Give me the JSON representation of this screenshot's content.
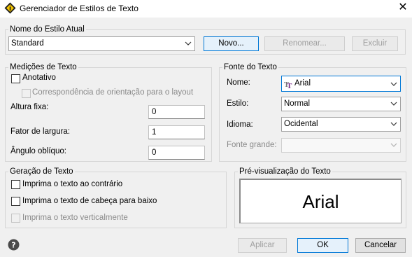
{
  "window": {
    "title": "Gerenciador de Estilos de Texto",
    "close_glyph": "✕"
  },
  "current_style": {
    "group_label": "Nome do Estilo Atual",
    "selected": "Standard",
    "new_button": "Novo...",
    "rename_button": "Renomear...",
    "delete_button": "Excluir"
  },
  "measurements": {
    "group_label": "Medições de Texto",
    "annotative_label": "Anotativo",
    "annotative_checked": false,
    "orientation_label": "Correspondência de orientação para o layout",
    "orientation_checked": false,
    "fixed_height_label": "Altura fixa:",
    "fixed_height_value": "0",
    "width_factor_label": "Fator de largura:",
    "width_factor_value": "1",
    "oblique_angle_label": "Ângulo oblíquo:",
    "oblique_angle_value": "0"
  },
  "font": {
    "group_label": "Fonte do Texto",
    "name_label": "Nome:",
    "name_value": "Arial",
    "name_icon": "truetype-font-icon",
    "style_label": "Estilo:",
    "style_value": "Normal",
    "language_label": "Idioma:",
    "language_value": "Ocidental",
    "bigfont_label": "Fonte grande:",
    "bigfont_value": ""
  },
  "generation": {
    "group_label": "Geração de Texto",
    "backwards_label": "Imprima o texto ao contrário",
    "backwards_checked": false,
    "upside_down_label": "Imprima o texto de cabeça para baixo",
    "upside_down_checked": false,
    "vertical_label": "Imprima o texto verticalmente",
    "vertical_checked": false
  },
  "preview": {
    "group_label": "Pré-visualização do Texto",
    "sample_text": "Arial"
  },
  "footer": {
    "help_icon": "help-icon",
    "apply_button": "Aplicar",
    "ok_button": "OK",
    "cancel_button": "Cancelar"
  },
  "colors": {
    "accent": "#0078d7",
    "dialog_bg": "#f0f0f0",
    "font_icon_purple": "#7b2a8a"
  }
}
